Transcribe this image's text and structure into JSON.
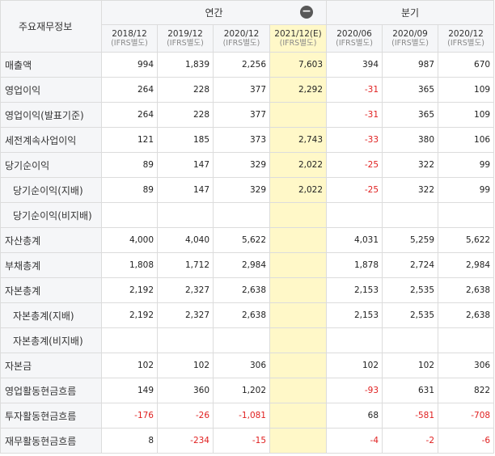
{
  "table": {
    "corner_label": "주요재무정보",
    "group_annual": "연간",
    "group_quarter": "분기",
    "collapse_icon_glyph": "−",
    "periods": [
      {
        "label": "2018/12",
        "sub": "(IFRS별도)"
      },
      {
        "label": "2019/12",
        "sub": "(IFRS별도)"
      },
      {
        "label": "2020/12",
        "sub": "(IFRS별도)"
      },
      {
        "label": "2021/12(E)",
        "sub": "(IFRS별도)"
      },
      {
        "label": "2020/06",
        "sub": "(IFRS별도)"
      },
      {
        "label": "2020/09",
        "sub": "(IFRS별도)"
      },
      {
        "label": "2020/12",
        "sub": "(IFRS별도)"
      }
    ],
    "rows": [
      {
        "label": "매출액",
        "indent": false,
        "values": [
          "994",
          "1,839",
          "2,256",
          "7,603",
          "394",
          "987",
          "670"
        ]
      },
      {
        "label": "영업이익",
        "indent": false,
        "values": [
          "264",
          "228",
          "377",
          "2,292",
          "-31",
          "365",
          "109"
        ]
      },
      {
        "label": "영업이익(발표기준)",
        "indent": false,
        "values": [
          "264",
          "228",
          "377",
          "",
          "-31",
          "365",
          "109"
        ]
      },
      {
        "label": "세전계속사업이익",
        "indent": false,
        "values": [
          "121",
          "185",
          "373",
          "2,743",
          "-33",
          "380",
          "106"
        ]
      },
      {
        "label": "당기순이익",
        "indent": false,
        "values": [
          "89",
          "147",
          "329",
          "2,022",
          "-25",
          "322",
          "99"
        ]
      },
      {
        "label": "당기순이익(지배)",
        "indent": true,
        "values": [
          "89",
          "147",
          "329",
          "2,022",
          "-25",
          "322",
          "99"
        ]
      },
      {
        "label": "당기순이익(비지배)",
        "indent": true,
        "values": [
          "",
          "",
          "",
          "",
          "",
          "",
          ""
        ]
      },
      {
        "label": "자산총계",
        "indent": false,
        "values": [
          "4,000",
          "4,040",
          "5,622",
          "",
          "4,031",
          "5,259",
          "5,622"
        ]
      },
      {
        "label": "부채총계",
        "indent": false,
        "values": [
          "1,808",
          "1,712",
          "2,984",
          "",
          "1,878",
          "2,724",
          "2,984"
        ]
      },
      {
        "label": "자본총계",
        "indent": false,
        "values": [
          "2,192",
          "2,327",
          "2,638",
          "",
          "2,153",
          "2,535",
          "2,638"
        ]
      },
      {
        "label": "자본총계(지배)",
        "indent": true,
        "values": [
          "2,192",
          "2,327",
          "2,638",
          "",
          "2,153",
          "2,535",
          "2,638"
        ]
      },
      {
        "label": "자본총계(비지배)",
        "indent": true,
        "values": [
          "",
          "",
          "",
          "",
          "",
          "",
          ""
        ]
      },
      {
        "label": "자본금",
        "indent": false,
        "values": [
          "102",
          "102",
          "306",
          "",
          "102",
          "102",
          "306"
        ]
      },
      {
        "label": "영업활동현금흐름",
        "indent": false,
        "values": [
          "149",
          "360",
          "1,202",
          "",
          "-93",
          "631",
          "822"
        ]
      },
      {
        "label": "투자활동현금흐름",
        "indent": false,
        "values": [
          "-176",
          "-26",
          "-1,081",
          "",
          "68",
          "-581",
          "-708"
        ]
      },
      {
        "label": "재무활동현금흐름",
        "indent": false,
        "values": [
          "8",
          "-234",
          "-15",
          "",
          "-4",
          "-2",
          "-6"
        ]
      }
    ]
  }
}
